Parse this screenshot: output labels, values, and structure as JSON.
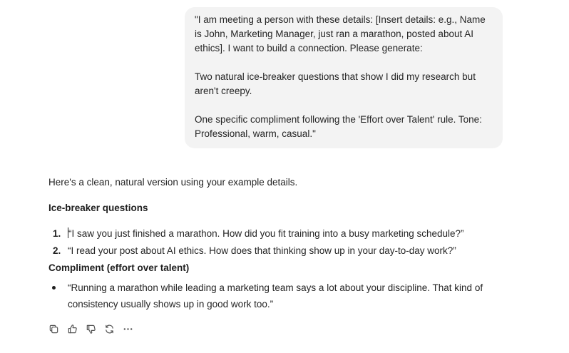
{
  "user_message": {
    "paragraph_1": "\"I am meeting a person with these details: [Insert details: e.g., Name is John, Marketing Manager, just ran a marathon, posted about AI ethics]. I want to build a connection. Please generate:",
    "paragraph_2": "Two natural ice-breaker questions that show I did my research but aren't creepy.",
    "paragraph_3": "One specific compliment following the 'Effort over Talent' rule. Tone: Professional, warm, casual.\""
  },
  "reply": {
    "intro": "Here's a clean, natural version using your example details.",
    "section_1_heading": "Ice-breaker questions",
    "questions": [
      {
        "num": "1.",
        "text": "“I saw you just finished a marathon. How did you fit training into a busy marketing schedule?”"
      },
      {
        "num": "2.",
        "text": "“I read your post about AI ethics. How does that thinking show up in your day-to-day work?”"
      }
    ],
    "section_2_heading": "Compliment (effort over talent)",
    "compliment": "“Running a marathon while leading a marketing team says a lot about your discipline. That kind of consistency usually shows up in good work too.”"
  },
  "actions": {
    "icons": [
      "copy-icon",
      "thumbs-up-icon",
      "thumbs-down-icon",
      "regenerate-icon",
      "more-icon"
    ]
  }
}
